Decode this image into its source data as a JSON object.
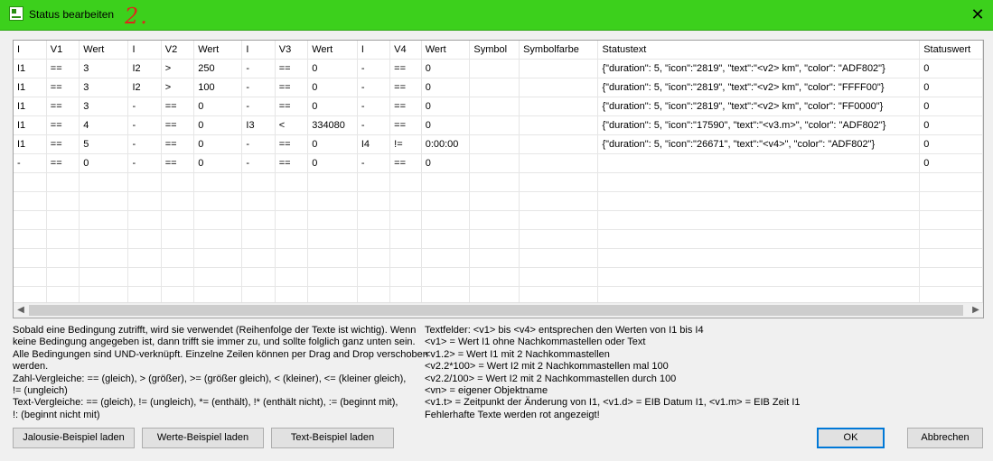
{
  "window": {
    "title": "Status bearbeiten",
    "annotation": "2."
  },
  "table": {
    "columns": [
      "I",
      "V1",
      "Wert",
      "I",
      "V2",
      "Wert",
      "I",
      "V3",
      "Wert",
      "I",
      "V4",
      "Wert",
      "Symbol",
      "Symbolfarbe",
      "Statustext",
      "Statuswert"
    ],
    "rows": [
      [
        "I1",
        "==",
        "3",
        "I2",
        ">",
        "250",
        "-",
        "==",
        "0",
        "-",
        "==",
        "0",
        "",
        "",
        "{\"duration\": 5, \"icon\":\"2819\", \"text\":\"<v2> km\", \"color\": \"ADF802\"}",
        "0"
      ],
      [
        "I1",
        "==",
        "3",
        "I2",
        ">",
        "100",
        "-",
        "==",
        "0",
        "-",
        "==",
        "0",
        "",
        "",
        "{\"duration\": 5, \"icon\":\"2819\", \"text\":\"<v2>  km\", \"color\": \"FFFF00\"}",
        "0"
      ],
      [
        "I1",
        "==",
        "3",
        "-",
        "==",
        "0",
        "-",
        "==",
        "0",
        "-",
        "==",
        "0",
        "",
        "",
        "{\"duration\": 5, \"icon\":\"2819\", \"text\":\"<v2> km\", \"color\": \"FF0000\"}",
        "0"
      ],
      [
        "I1",
        "==",
        "4",
        "-",
        "==",
        "0",
        "I3",
        "<",
        "334080",
        "-",
        "==",
        "0",
        "",
        "",
        "{\"duration\": 5, \"icon\":\"17590\", \"text\":\"<v3.m>\", \"color\": \"ADF802\"}",
        "0"
      ],
      [
        "I1",
        "==",
        "5",
        "-",
        "==",
        "0",
        "-",
        "==",
        "0",
        "I4",
        "!=",
        "0:00:00",
        "",
        "",
        "{\"duration\": 5, \"icon\":\"26671\", \"text\":\"<v4>\", \"color\": \"ADF802\"}",
        "0"
      ],
      [
        "-",
        "==",
        "0",
        "-",
        "==",
        "0",
        "-",
        "==",
        "0",
        "-",
        "==",
        "0",
        "",
        "",
        "",
        "0"
      ]
    ]
  },
  "help_left": [
    "Sobald eine Bedingung zutrifft, wird sie verwendet (Reihenfolge der Texte ist wichtig). Wenn",
    "keine Bedingung angegeben ist, dann trifft sie immer zu, und sollte folglich ganz unten sein.",
    "Alle Bedingungen sind UND-verknüpft. Einzelne Zeilen können per Drag and Drop verschoben",
    "werden.",
    "Zahl-Vergleiche: == (gleich), > (größer), >= (größer gleich), < (kleiner), <= (kleiner gleich),",
    "!= (ungleich)",
    "Text-Vergleiche: == (gleich), != (ungleich), *= (enthält), !* (enthält nicht), := (beginnt mit),",
    "!: (beginnt nicht mit)"
  ],
  "help_right": [
    "Textfelder: <v1> bis <v4> entsprechen den Werten von I1 bis I4",
    "<v1> = Wert I1 ohne Nachkommastellen oder Text",
    "<v1.2> = Wert I1 mit 2 Nachkommastellen",
    "<v2.2*100> = Wert I2 mit 2 Nachkommastellen mal 100",
    "<v2.2/100> = Wert I2 mit 2 Nachkommastellen durch 100",
    "<vn> = eigener Objektname",
    "<v1.t> = Zeitpunkt der Änderung von I1, <v1.d> = EIB Datum I1, <v1.m> = EIB Zeit I1",
    "Fehlerhafte Texte werden rot angezeigt!"
  ],
  "buttons": {
    "jalousie": "Jalousie-Beispiel laden",
    "werte": "Werte-Beispiel laden",
    "text": "Text-Beispiel laden",
    "ok": "OK",
    "cancel": "Abbrechen"
  },
  "icons": {
    "close": "close-icon",
    "scroll_left": "chevron-left-icon",
    "scroll_right": "chevron-right-icon"
  }
}
